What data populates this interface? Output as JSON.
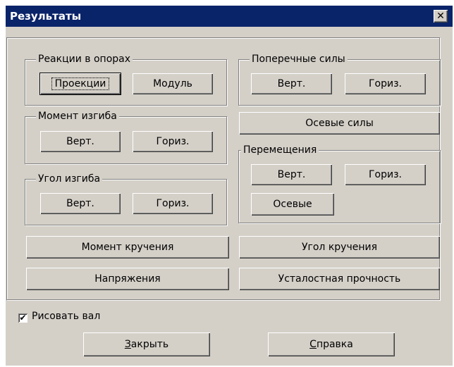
{
  "window": {
    "title": "Результаты",
    "close_glyph": "✕"
  },
  "groups": {
    "reactions": {
      "label": "Реакции в опорах",
      "projections": "Проекции",
      "module": "Модуль"
    },
    "bending_moment": {
      "label": "Момент изгиба",
      "vert": "Верт.",
      "horiz": "Гориз."
    },
    "bending_angle": {
      "label": "Угол изгиба",
      "vert": "Верт.",
      "horiz": "Гориз."
    },
    "shear_forces": {
      "label": "Поперечные силы",
      "vert": "Верт.",
      "horiz": "Гориз."
    },
    "displacements": {
      "label": "Перемещения",
      "vert": "Верт.",
      "horiz": "Гориз.",
      "axial": "Осевые"
    }
  },
  "buttons": {
    "axial_forces": "Осевые силы",
    "torque_moment": "Момент кручения",
    "torsion_angle": "Угол кручения",
    "stresses": "Напряжения",
    "fatigue_strength": "Усталостная прочность"
  },
  "checkbox": {
    "label": "Рисовать вал",
    "checked": true,
    "mark": "✔"
  },
  "footer": {
    "close_hotkey": "З",
    "close_rest": "акрыть",
    "help_hotkey": "С",
    "help_rest": "правка"
  }
}
